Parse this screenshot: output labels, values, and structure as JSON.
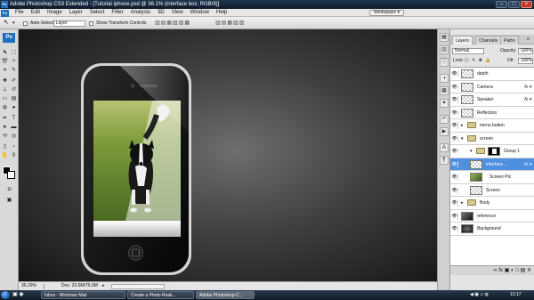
{
  "window": {
    "title": "Adobe Photoshop CS3 Extended - [Tutorial iphone.psd @ 36.1% (interface box, RGB/8)]",
    "app_icon": "Ps"
  },
  "menu": {
    "logo": "Ps",
    "items": [
      "File",
      "Edit",
      "Image",
      "Layer",
      "Select",
      "Filter",
      "Analysis",
      "3D",
      "View",
      "Window",
      "Help"
    ],
    "workspace": "Workspace ▾"
  },
  "options_bar": {
    "tool_icon": "↖",
    "auto_select_label": "Auto-Select:",
    "auto_select_value": "Layer",
    "show_transform_label": "Show Transform Controls"
  },
  "tools": {
    "ps_badge": "Ps"
  },
  "status": {
    "zoom": "36.29%",
    "doc": "Doc: 20.6M/76.9M"
  },
  "panel": {
    "tabs": [
      "Layers",
      "Channels",
      "Paths"
    ],
    "blend_mode": "Normal",
    "opacity_label": "Opacity:",
    "opacity_value": "100%",
    "lock_label": "Lock:",
    "fill_label": "Fill:",
    "fill_value": "100%",
    "layers": [
      {
        "name": "depth",
        "indent": 0,
        "kind": "layer",
        "fx": false
      },
      {
        "name": "Camera",
        "indent": 0,
        "kind": "layer",
        "fx": true
      },
      {
        "name": "Speaker",
        "indent": 0,
        "kind": "layer",
        "fx": true
      },
      {
        "name": "Reflection",
        "indent": 0,
        "kind": "layer",
        "fx": false
      },
      {
        "name": "menu button",
        "indent": 0,
        "kind": "group",
        "fx": false
      },
      {
        "name": "screen",
        "indent": 0,
        "kind": "group-open",
        "fx": false
      },
      {
        "name": "Group 1",
        "indent": 1,
        "kind": "group-mask",
        "fx": false
      },
      {
        "name": "interface ...",
        "indent": 1,
        "kind": "layer",
        "fx": true,
        "selected": true
      },
      {
        "name": "Screen Pic",
        "indent": 1,
        "kind": "photo",
        "fx": false
      },
      {
        "name": "Screen",
        "indent": 1,
        "kind": "layer",
        "fx": false
      },
      {
        "name": "Body",
        "indent": 0,
        "kind": "group",
        "fx": false
      },
      {
        "name": "reference",
        "indent": 0,
        "kind": "photo-dark",
        "fx": false
      },
      {
        "name": "Background",
        "indent": 0,
        "kind": "background",
        "fx": false
      }
    ],
    "bottom_icons": "∞ fx ▣ ◐ □ ▤ ✕"
  },
  "taskbar": {
    "tasks": [
      "Inbox - Windows Mail",
      "Create a Photo Reali...",
      "Adobe Photoshop C..."
    ],
    "clock": "13:17"
  }
}
